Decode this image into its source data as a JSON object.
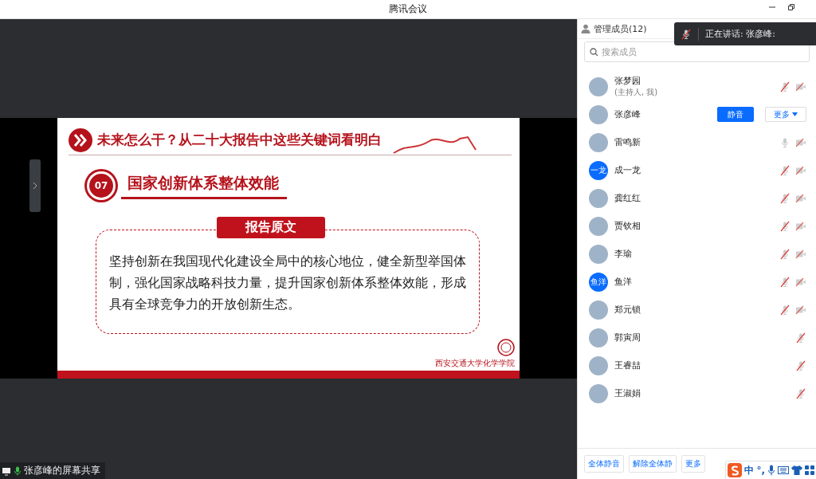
{
  "window": {
    "title": "腾讯会议"
  },
  "share": {
    "label": "张彦峰的屏幕共享"
  },
  "slide": {
    "header": "未来怎么干？从二十大报告中这些关键词看明白",
    "section_number": "07",
    "section_title": "国家创新体系整体效能",
    "quote_label": "报告原文",
    "quote_text": "坚持创新在我国现代化建设全局中的核心地位，健全新型举国体制，强化国家战略科技力量，提升国家创新体系整体效能，形成具有全球竞争力的开放创新生态。",
    "logo_text": "西安交通大学化学学院"
  },
  "panel": {
    "title": "管理成员(12)",
    "search": {
      "placeholder": "搜索成员"
    },
    "members": [
      {
        "name": "张梦园",
        "note": "(主持人, 我)",
        "mic_muted": true,
        "camera_off": true
      },
      {
        "name": "张彦峰",
        "actions": [
          "静音",
          "更多"
        ]
      },
      {
        "name": "雷鸣新",
        "mic_muted": false,
        "camera_off": true
      },
      {
        "name": "成一龙",
        "avatar_text": "一龙",
        "mic_muted": true,
        "camera_off": true
      },
      {
        "name": "龚红红",
        "mic_muted": true,
        "camera_off": true
      },
      {
        "name": "贾钦相",
        "mic_muted": true,
        "camera_off": true
      },
      {
        "name": "李瑜",
        "mic_muted": true,
        "camera_off": true
      },
      {
        "name": "鱼洋",
        "avatar_text": "鱼洋",
        "mic_muted": true,
        "camera_off": true
      },
      {
        "name": "郑元锁",
        "mic_muted": true,
        "camera_off": true
      },
      {
        "name": "郭寅周",
        "mic_muted": true
      },
      {
        "name": "王睿喆",
        "mic_muted": true
      },
      {
        "name": "王淑娟",
        "mic_muted": true
      }
    ],
    "footer_buttons": [
      "全体静音",
      "解除全体静",
      "更多"
    ]
  },
  "toast": {
    "text": "正在讲话: 张彦峰:"
  },
  "ime": {
    "items": [
      "中",
      "°,"
    ]
  }
}
